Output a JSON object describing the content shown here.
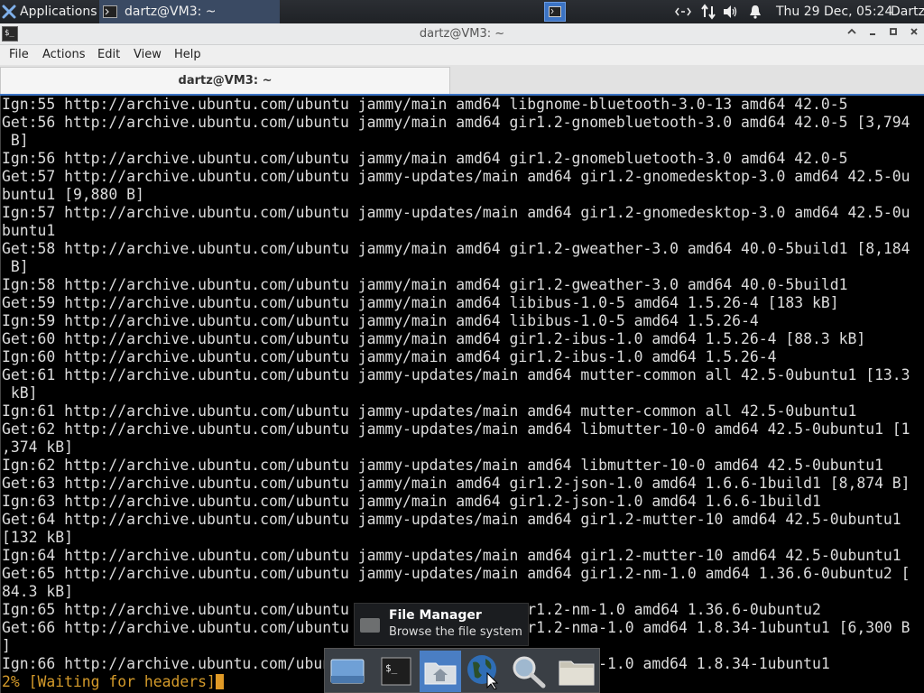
{
  "top_panel": {
    "apps_label": "Applications",
    "task_label": "dartz@VM3: ~",
    "clock": "Thu 29 Dec, 05:24",
    "user": "Dartz"
  },
  "window": {
    "title": "dartz@VM3: ~"
  },
  "menubar": {
    "items": [
      "File",
      "Actions",
      "Edit",
      "View",
      "Help"
    ]
  },
  "tabs": [
    {
      "label": "dartz@VM3: ~"
    }
  ],
  "terminal": {
    "lines": [
      "Ign:55 http://archive.ubuntu.com/ubuntu jammy/main amd64 libgnome-bluetooth-3.0-13 amd64 42.0-5",
      "Get:56 http://archive.ubuntu.com/ubuntu jammy/main amd64 gir1.2-gnomebluetooth-3.0 amd64 42.0-5 [3,794",
      " B]",
      "Ign:56 http://archive.ubuntu.com/ubuntu jammy/main amd64 gir1.2-gnomebluetooth-3.0 amd64 42.0-5",
      "Get:57 http://archive.ubuntu.com/ubuntu jammy-updates/main amd64 gir1.2-gnomedesktop-3.0 amd64 42.5-0u",
      "buntu1 [9,880 B]",
      "Ign:57 http://archive.ubuntu.com/ubuntu jammy-updates/main amd64 gir1.2-gnomedesktop-3.0 amd64 42.5-0u",
      "buntu1",
      "Get:58 http://archive.ubuntu.com/ubuntu jammy/main amd64 gir1.2-gweather-3.0 amd64 40.0-5build1 [8,184",
      " B]",
      "Ign:58 http://archive.ubuntu.com/ubuntu jammy/main amd64 gir1.2-gweather-3.0 amd64 40.0-5build1",
      "Get:59 http://archive.ubuntu.com/ubuntu jammy/main amd64 libibus-1.0-5 amd64 1.5.26-4 [183 kB]",
      "Ign:59 http://archive.ubuntu.com/ubuntu jammy/main amd64 libibus-1.0-5 amd64 1.5.26-4",
      "Get:60 http://archive.ubuntu.com/ubuntu jammy/main amd64 gir1.2-ibus-1.0 amd64 1.5.26-4 [88.3 kB]",
      "Ign:60 http://archive.ubuntu.com/ubuntu jammy/main amd64 gir1.2-ibus-1.0 amd64 1.5.26-4",
      "Get:61 http://archive.ubuntu.com/ubuntu jammy-updates/main amd64 mutter-common all 42.5-0ubuntu1 [13.3",
      " kB]",
      "Ign:61 http://archive.ubuntu.com/ubuntu jammy-updates/main amd64 mutter-common all 42.5-0ubuntu1",
      "Get:62 http://archive.ubuntu.com/ubuntu jammy-updates/main amd64 libmutter-10-0 amd64 42.5-0ubuntu1 [1",
      ",374 kB]",
      "Ign:62 http://archive.ubuntu.com/ubuntu jammy-updates/main amd64 libmutter-10-0 amd64 42.5-0ubuntu1",
      "Get:63 http://archive.ubuntu.com/ubuntu jammy/main amd64 gir1.2-json-1.0 amd64 1.6.6-1build1 [8,874 B]",
      "Ign:63 http://archive.ubuntu.com/ubuntu jammy/main amd64 gir1.2-json-1.0 amd64 1.6.6-1build1",
      "Get:64 http://archive.ubuntu.com/ubuntu jammy-updates/main amd64 gir1.2-mutter-10 amd64 42.5-0ubuntu1",
      "[132 kB]",
      "Ign:64 http://archive.ubuntu.com/ubuntu jammy-updates/main amd64 gir1.2-mutter-10 amd64 42.5-0ubuntu1",
      "Get:65 http://archive.ubuntu.com/ubuntu jammy-updates/main amd64 gir1.2-nm-1.0 amd64 1.36.6-0ubuntu2 [",
      "84.3 kB]",
      "Ign:65 http://archive.ubuntu.com/ubuntu jammy/main amd64 gir1.2-nm-1.0 amd64 1.36.6-0ubuntu2",
      "Get:66 http://archive.ubuntu.com/ubuntu jammy/main amd64 gir1.2-nma-1.0 amd64 1.8.34-1ubuntu1 [6,300 B",
      "]",
      "Ign:66 http://archive.ubuntu.com/ubuntu jammy/main amd64 gir1.2-nma-1.0 amd64 1.8.34-1ubuntu1"
    ],
    "status_line": "2% [Waiting for headers]"
  },
  "dock": {
    "items": [
      {
        "icon": "show-desktop-icon"
      },
      {
        "icon": "terminal-icon"
      },
      {
        "icon": "home-folder-icon"
      },
      {
        "icon": "web-browser-icon"
      },
      {
        "icon": "search-icon"
      },
      {
        "icon": "folder-icon"
      }
    ]
  },
  "tooltip": {
    "title": "File Manager",
    "description": "Browse the file system"
  },
  "colors": {
    "accent": "#3b73c4",
    "terminal_bg": "#000000",
    "terminal_fg": "#dcdcdc",
    "status_fg": "#d49a2a"
  }
}
